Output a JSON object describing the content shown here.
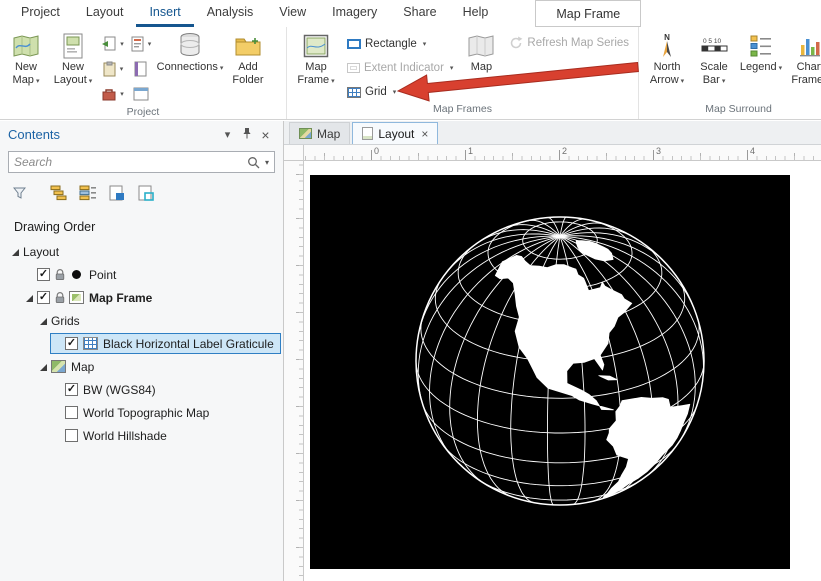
{
  "ribbon": {
    "tabs": [
      "Project",
      "Layout",
      "Insert",
      "Analysis",
      "View",
      "Imagery",
      "Share",
      "Help"
    ],
    "active_tab": "Insert",
    "contextual_tab": "Map Frame",
    "project_group": {
      "label": "Project",
      "new_map": "New Map",
      "new_layout": "New Layout",
      "connections": "Connections",
      "add_folder": "Add Folder"
    },
    "map_frames_group": {
      "label": "Map Frames",
      "map_frame": "Map Frame",
      "rectangle": "Rectangle",
      "extent_indicator": "Extent Indicator",
      "grid": "Grid",
      "map": "Map",
      "refresh_map_series": "Refresh Map Series"
    },
    "map_surround_group": {
      "label": "Map Surround",
      "north_arrow": "North Arrow",
      "scale_bar": "Scale Bar",
      "legend": "Legend",
      "chart_frame": "Chart Frame",
      "scale_bar_icon_text": "0 5 10",
      "north_arrow_icon_text": "N"
    }
  },
  "contents": {
    "title": "Contents",
    "search_placeholder": "Search",
    "drawing_order_label": "Drawing Order",
    "tree": [
      {
        "label": "Layout",
        "level": 0,
        "expander": true
      },
      {
        "label": "Point",
        "level": 1,
        "checkbox": "checked",
        "lock": true,
        "icon": "point"
      },
      {
        "label": "Map Frame",
        "level": 1,
        "expander": true,
        "checkbox": "checked",
        "lock": true,
        "icon": "map-frame",
        "bold": true
      },
      {
        "label": "Grids",
        "level": 2,
        "expander": true
      },
      {
        "label": "Black Horizontal Label Graticule",
        "level": 3,
        "checkbox": "checked",
        "icon": "graticule",
        "selected": true
      },
      {
        "label": "Map",
        "level": 2,
        "expander": true,
        "icon": "map"
      },
      {
        "label": "BW (WGS84)",
        "level": 3,
        "checkbox": "checked"
      },
      {
        "label": "World Topographic Map",
        "level": 3,
        "checkbox": "unchecked"
      },
      {
        "label": "World Hillshade",
        "level": 3,
        "checkbox": "unchecked"
      }
    ]
  },
  "view": {
    "tabs": [
      {
        "label": "Map",
        "active": false
      },
      {
        "label": "Layout",
        "active": true,
        "closable": true
      }
    ],
    "ruler_ticks": [
      "0",
      "1",
      "2",
      "3",
      "4"
    ]
  },
  "icons": {
    "dropdown": "▾",
    "close": "×",
    "checkmark": "✓",
    "search": "magnifier-svg",
    "filter": "funnel-svg",
    "pin": "pushpin-svg",
    "lock": "padlock-svg",
    "annotation_arrow": "red-arrow-polygon"
  },
  "colors": {
    "accent_blue": "#15568f",
    "selection_bg": "#cde6f7",
    "selection_border": "#2f7fc4",
    "arrow_red": "#d8402f",
    "map_frame_fill": "#000000",
    "globe_lines": "#ffffff"
  }
}
